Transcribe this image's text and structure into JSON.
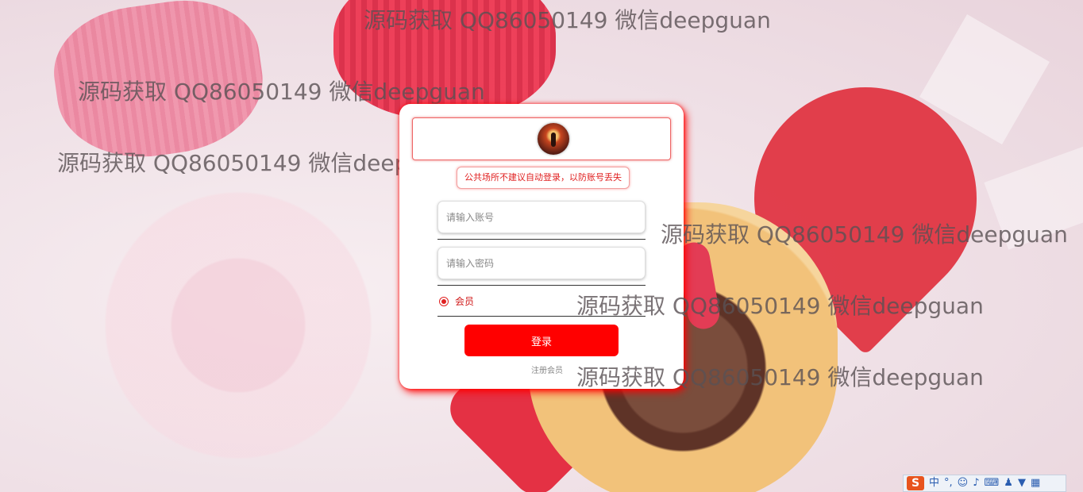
{
  "watermark": "源码获取 QQ86050149 微信deepguan",
  "login": {
    "notice": "公共场所不建议自动登录，以防账号丢失",
    "username_placeholder": "请输入账号",
    "password_placeholder": "请输入密码",
    "role_label": "会员",
    "login_button": "登录",
    "register_link": "注册会员"
  },
  "ime_toolbar": {
    "logo": "S",
    "mode": "中",
    "punct": "°,",
    "icons": [
      "smile-icon",
      "microphone-icon",
      "keyboard-icon",
      "user-icon",
      "shirt-icon",
      "grid-icon"
    ]
  }
}
